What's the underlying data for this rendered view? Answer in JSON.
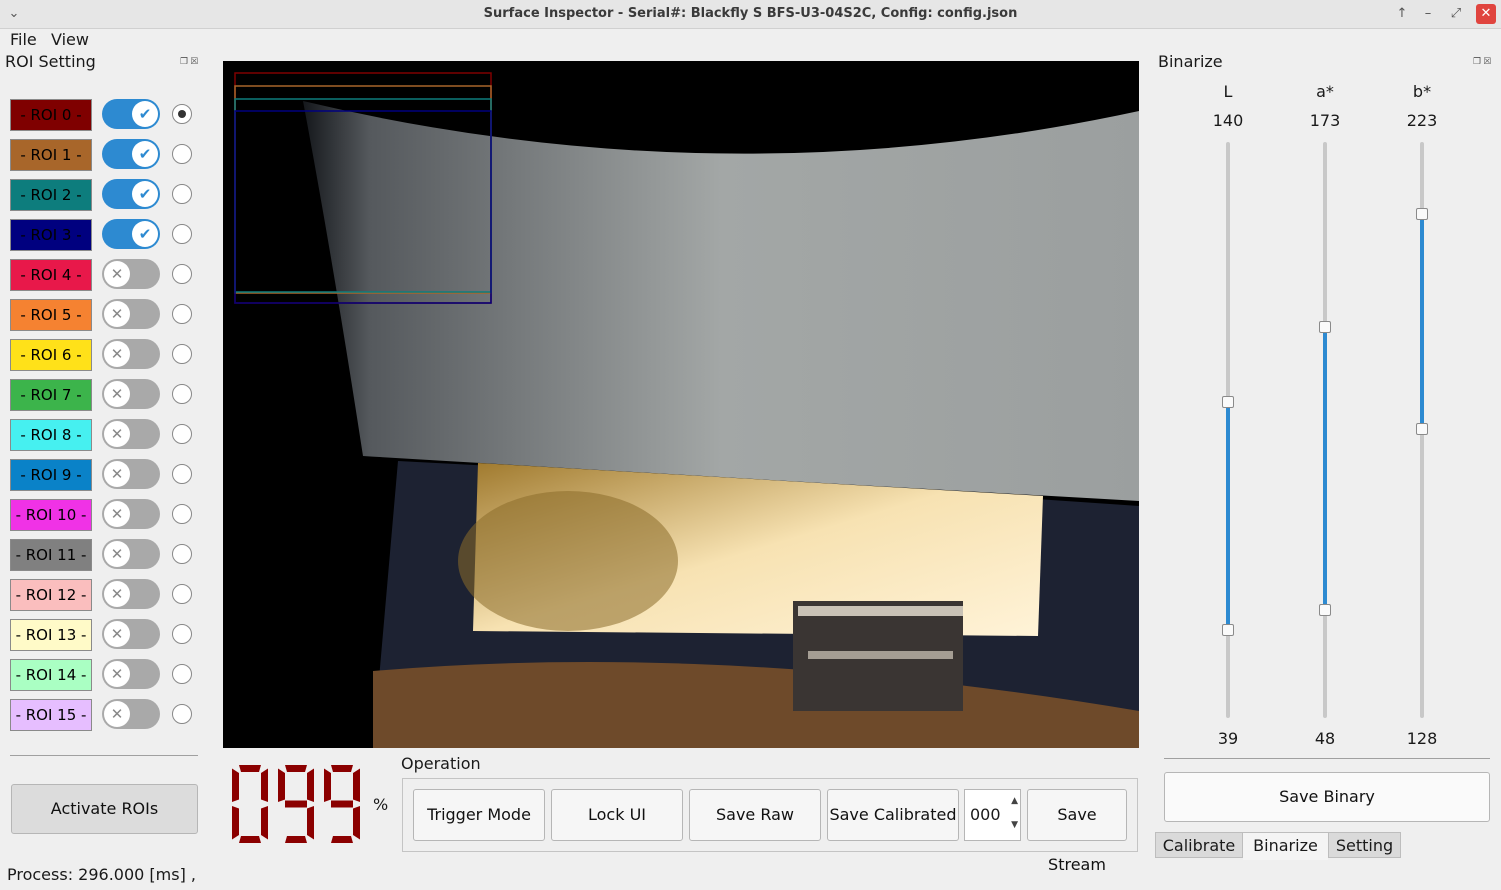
{
  "window": {
    "title": "Surface Inspector - Serial#: Blackfly S BFS-U3-04S2C, Config: config.json",
    "controls": [
      "↑",
      "–",
      "⤢",
      "✕"
    ]
  },
  "menu": [
    "File",
    "View"
  ],
  "roi_panel": {
    "title": "ROI Setting",
    "activate_label": "Activate ROIs",
    "rois": [
      {
        "label": "- ROI 0 -",
        "color": "#7f0000",
        "enabled": true,
        "selected": true
      },
      {
        "label": "- ROI 1 -",
        "color": "#a8662a",
        "enabled": true,
        "selected": false
      },
      {
        "label": "- ROI 2 -",
        "color": "#0d7d7d",
        "enabled": true,
        "selected": false
      },
      {
        "label": "- ROI 3 -",
        "color": "#00007f",
        "enabled": true,
        "selected": false
      },
      {
        "label": "- ROI 4 -",
        "color": "#e8184a",
        "enabled": false,
        "selected": false
      },
      {
        "label": "- ROI 5 -",
        "color": "#f58231",
        "enabled": false,
        "selected": false
      },
      {
        "label": "- ROI 6 -",
        "color": "#ffe119",
        "enabled": false,
        "selected": false
      },
      {
        "label": "- ROI 7 -",
        "color": "#3cb44b",
        "enabled": false,
        "selected": false
      },
      {
        "label": "- ROI 8 -",
        "color": "#46f0f0",
        "enabled": false,
        "selected": false
      },
      {
        "label": "- ROI 9 -",
        "color": "#0a82c8",
        "enabled": false,
        "selected": false
      },
      {
        "label": "- ROI 10 -",
        "color": "#f032e6",
        "enabled": false,
        "selected": false
      },
      {
        "label": "- ROI 11 -",
        "color": "#808080",
        "enabled": false,
        "selected": false
      },
      {
        "label": "- ROI 12 -",
        "color": "#fabebe",
        "enabled": false,
        "selected": false
      },
      {
        "label": "- ROI 13 -",
        "color": "#fffac8",
        "enabled": false,
        "selected": false
      },
      {
        "label": "- ROI 14 -",
        "color": "#aaffc3",
        "enabled": false,
        "selected": false
      },
      {
        "label": "- ROI 15 -",
        "color": "#e6beff",
        "enabled": false,
        "selected": false
      }
    ]
  },
  "display": {
    "value": "099",
    "unit": "%",
    "color": "#8b0000"
  },
  "operation": {
    "title": "Operation",
    "buttons": [
      "Trigger Mode",
      "Lock UI",
      "Save Raw",
      "Save Calibrated",
      "Save Stream"
    ],
    "spin_value": "000"
  },
  "binarize": {
    "title": "Binarize",
    "channels": [
      {
        "name": "L",
        "upper": "140",
        "lower": "39",
        "upper_frac": 0.549,
        "lower_frac": 0.153
      },
      {
        "name": "a*",
        "upper": "173",
        "lower": "48",
        "upper_frac": 0.678,
        "lower_frac": 0.188
      },
      {
        "name": "b*",
        "upper": "223",
        "lower": "128",
        "upper_frac": 0.875,
        "lower_frac": 0.502
      }
    ],
    "save_label": "Save Binary",
    "tabs": [
      "Calibrate",
      "Binarize",
      "Setting"
    ],
    "active_tab": "Binarize"
  },
  "status": {
    "text": "Process: 296.000 [ms] ,"
  },
  "icons": {
    "window_menu": "chevron-down-icon",
    "dock_float": "float-icon",
    "dock_close": "close-icon",
    "spin": "spin-arrows-icon"
  }
}
